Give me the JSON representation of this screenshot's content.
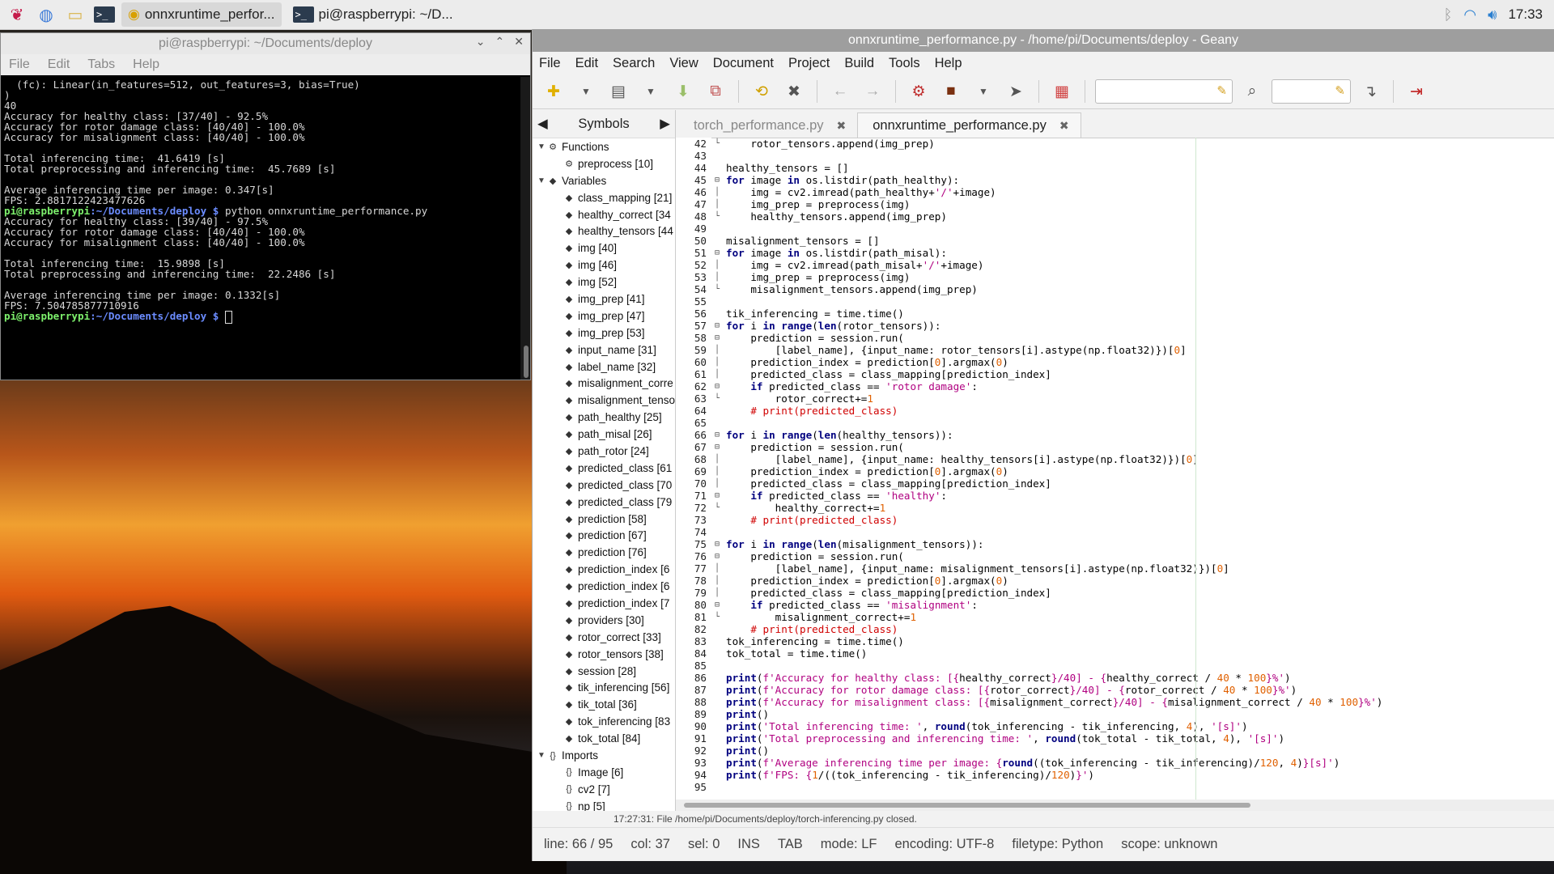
{
  "taskbar": {
    "tasks": [
      {
        "label": "onnxruntime_perfor..."
      },
      {
        "label": "pi@raspberrypi: ~/D..."
      }
    ],
    "clock": "17:33"
  },
  "terminal": {
    "title": "pi@raspberrypi: ~/Documents/deploy",
    "menu": [
      "File",
      "Edit",
      "Tabs",
      "Help"
    ],
    "lines": [
      "  (fc): Linear(in_features=512, out_features=3, bias=True)",
      ")",
      "40",
      "Accuracy for healthy class: [37/40] - 92.5%",
      "Accuracy for rotor damage class: [40/40] - 100.0%",
      "Accuracy for misalignment class: [40/40] - 100.0%",
      "",
      "Total inferencing time:  41.6419 [s]",
      "Total preprocessing and inferencing time:  45.7689 [s]",
      "",
      "Average inferencing time per image: 0.347[s]",
      "FPS: 2.8817122423477626",
      "PROMPT1",
      "Accuracy for healthy class: [39/40] - 97.5%",
      "Accuracy for rotor damage class: [40/40] - 100.0%",
      "Accuracy for misalignment class: [40/40] - 100.0%",
      "",
      "Total inferencing time:  15.9898 [s]",
      "Total preprocessing and inferencing time:  22.2486 [s]",
      "",
      "Average inferencing time per image: 0.1332[s]",
      "FPS: 7.504785877710916",
      "PROMPT2"
    ],
    "prompt_user": "pi@raspberrypi",
    "prompt_path": ":~/Documents/deploy $",
    "command1": " python onnxruntime_performance.py",
    "command2": " "
  },
  "geany": {
    "title": "onnxruntime_performance.py - /home/pi/Documents/deploy - Geany",
    "menu": [
      "File",
      "Edit",
      "Search",
      "View",
      "Document",
      "Project",
      "Build",
      "Tools",
      "Help"
    ],
    "sidebar_tab": "Symbols",
    "symbols": [
      {
        "depth": 0,
        "tw": "▼",
        "icon": "⚙",
        "label": "Functions"
      },
      {
        "depth": 1,
        "tw": "",
        "icon": "⚙",
        "label": "preprocess [10]"
      },
      {
        "depth": 0,
        "tw": "▼",
        "icon": "◆",
        "label": "Variables"
      },
      {
        "depth": 1,
        "tw": "",
        "icon": "◆",
        "label": "class_mapping [21]"
      },
      {
        "depth": 1,
        "tw": "",
        "icon": "◆",
        "label": "healthy_correct [34"
      },
      {
        "depth": 1,
        "tw": "",
        "icon": "◆",
        "label": "healthy_tensors [44"
      },
      {
        "depth": 1,
        "tw": "",
        "icon": "◆",
        "label": "img [40]"
      },
      {
        "depth": 1,
        "tw": "",
        "icon": "◆",
        "label": "img [46]"
      },
      {
        "depth": 1,
        "tw": "",
        "icon": "◆",
        "label": "img [52]"
      },
      {
        "depth": 1,
        "tw": "",
        "icon": "◆",
        "label": "img_prep [41]"
      },
      {
        "depth": 1,
        "tw": "",
        "icon": "◆",
        "label": "img_prep [47]"
      },
      {
        "depth": 1,
        "tw": "",
        "icon": "◆",
        "label": "img_prep [53]"
      },
      {
        "depth": 1,
        "tw": "",
        "icon": "◆",
        "label": "input_name [31]"
      },
      {
        "depth": 1,
        "tw": "",
        "icon": "◆",
        "label": "label_name [32]"
      },
      {
        "depth": 1,
        "tw": "",
        "icon": "◆",
        "label": "misalignment_corre"
      },
      {
        "depth": 1,
        "tw": "",
        "icon": "◆",
        "label": "misalignment_tenso"
      },
      {
        "depth": 1,
        "tw": "",
        "icon": "◆",
        "label": "path_healthy [25]"
      },
      {
        "depth": 1,
        "tw": "",
        "icon": "◆",
        "label": "path_misal [26]"
      },
      {
        "depth": 1,
        "tw": "",
        "icon": "◆",
        "label": "path_rotor [24]"
      },
      {
        "depth": 1,
        "tw": "",
        "icon": "◆",
        "label": "predicted_class [61"
      },
      {
        "depth": 1,
        "tw": "",
        "icon": "◆",
        "label": "predicted_class [70"
      },
      {
        "depth": 1,
        "tw": "",
        "icon": "◆",
        "label": "predicted_class [79"
      },
      {
        "depth": 1,
        "tw": "",
        "icon": "◆",
        "label": "prediction [58]"
      },
      {
        "depth": 1,
        "tw": "",
        "icon": "◆",
        "label": "prediction [67]"
      },
      {
        "depth": 1,
        "tw": "",
        "icon": "◆",
        "label": "prediction [76]"
      },
      {
        "depth": 1,
        "tw": "",
        "icon": "◆",
        "label": "prediction_index [6"
      },
      {
        "depth": 1,
        "tw": "",
        "icon": "◆",
        "label": "prediction_index [6"
      },
      {
        "depth": 1,
        "tw": "",
        "icon": "◆",
        "label": "prediction_index [7"
      },
      {
        "depth": 1,
        "tw": "",
        "icon": "◆",
        "label": "providers [30]"
      },
      {
        "depth": 1,
        "tw": "",
        "icon": "◆",
        "label": "rotor_correct [33]"
      },
      {
        "depth": 1,
        "tw": "",
        "icon": "◆",
        "label": "rotor_tensors [38]"
      },
      {
        "depth": 1,
        "tw": "",
        "icon": "◆",
        "label": "session [28]"
      },
      {
        "depth": 1,
        "tw": "",
        "icon": "◆",
        "label": "tik_inferencing [56]"
      },
      {
        "depth": 1,
        "tw": "",
        "icon": "◆",
        "label": "tik_total [36]"
      },
      {
        "depth": 1,
        "tw": "",
        "icon": "◆",
        "label": "tok_inferencing [83"
      },
      {
        "depth": 1,
        "tw": "",
        "icon": "◆",
        "label": "tok_total [84]"
      },
      {
        "depth": 0,
        "tw": "▼",
        "icon": "{}",
        "label": "Imports"
      },
      {
        "depth": 1,
        "tw": "",
        "icon": "{}",
        "label": "Image [6]"
      },
      {
        "depth": 1,
        "tw": "",
        "icon": "{}",
        "label": "cv2 [7]"
      },
      {
        "depth": 1,
        "tw": "",
        "icon": "{}",
        "label": "np [5]"
      }
    ],
    "tabs": [
      {
        "label": "torch_performance.py",
        "active": false
      },
      {
        "label": "onnxruntime_performance.py",
        "active": true
      }
    ],
    "code_lines": [
      {
        "n": "42",
        "f": "└",
        "h": "    rotor_tensors.append(img_prep)"
      },
      {
        "n": "43",
        "f": "",
        "h": ""
      },
      {
        "n": "44",
        "f": "",
        "h": "healthy_tensors = []"
      },
      {
        "n": "45",
        "f": "⊟",
        "h": "<span class='k'>for</span> image <span class='k'>in</span> os.listdir(path_healthy):"
      },
      {
        "n": "46",
        "f": "│",
        "h": "    img = cv2.imread(path_healthy+<span class='s'>'/'</span>+image)"
      },
      {
        "n": "47",
        "f": "│",
        "h": "    img_prep = preprocess(img)"
      },
      {
        "n": "48",
        "f": "└",
        "h": "    healthy_tensors.append(img_prep)"
      },
      {
        "n": "49",
        "f": "",
        "h": ""
      },
      {
        "n": "50",
        "f": "",
        "h": "misalignment_tensors = []"
      },
      {
        "n": "51",
        "f": "⊟",
        "h": "<span class='k'>for</span> image <span class='k'>in</span> os.listdir(path_misal):"
      },
      {
        "n": "52",
        "f": "│",
        "h": "    img = cv2.imread(path_misal+<span class='s'>'/'</span>+image)"
      },
      {
        "n": "53",
        "f": "│",
        "h": "    img_prep = preprocess(img)"
      },
      {
        "n": "54",
        "f": "└",
        "h": "    misalignment_tensors.append(img_prep)"
      },
      {
        "n": "55",
        "f": "",
        "h": ""
      },
      {
        "n": "56",
        "f": "",
        "h": "tik_inferencing = time.time()"
      },
      {
        "n": "57",
        "f": "⊟",
        "h": "<span class='k'>for</span> i <span class='k'>in</span> <span class='k'>range</span>(<span class='k'>len</span>(rotor_tensors)):"
      },
      {
        "n": "58",
        "f": "⊟",
        "h": "    prediction = session.run("
      },
      {
        "n": "59",
        "f": "│",
        "h": "        [label_name], {input_name: rotor_tensors[i].astype(np.float32)})[<span class='n'>0</span>]"
      },
      {
        "n": "60",
        "f": "│",
        "h": "    prediction_index = prediction[<span class='n'>0</span>].argmax(<span class='n'>0</span>)"
      },
      {
        "n": "61",
        "f": "│",
        "h": "    predicted_class = class_mapping[prediction_index]"
      },
      {
        "n": "62",
        "f": "⊟",
        "h": "    <span class='k'>if</span> predicted_class == <span class='s'>'rotor damage'</span>:"
      },
      {
        "n": "63",
        "f": "└",
        "h": "        rotor_correct+=<span class='n'>1</span>"
      },
      {
        "n": "64",
        "f": "",
        "h": "    <span class='cm'># print(predicted_class)</span>"
      },
      {
        "n": "65",
        "f": "",
        "h": ""
      },
      {
        "n": "66",
        "f": "⊟",
        "h": "<span class='k'>for</span> i <span class='k'>in</span> <span class='k'>range</span>(<span class='k'>len</span>(healthy_tensors)):"
      },
      {
        "n": "67",
        "f": "⊟",
        "h": "    prediction = session.run("
      },
      {
        "n": "68",
        "f": "│",
        "h": "        [label_name], {input_name: healthy_tensors[i].astype(np.float32)})[<span class='n'>0</span>]"
      },
      {
        "n": "69",
        "f": "│",
        "h": "    prediction_index = prediction[<span class='n'>0</span>].argmax(<span class='n'>0</span>)"
      },
      {
        "n": "70",
        "f": "│",
        "h": "    predicted_class = class_mapping[prediction_index]"
      },
      {
        "n": "71",
        "f": "⊟",
        "h": "    <span class='k'>if</span> predicted_class == <span class='s'>'healthy'</span>:"
      },
      {
        "n": "72",
        "f": "└",
        "h": "        healthy_correct+=<span class='n'>1</span>"
      },
      {
        "n": "73",
        "f": "",
        "h": "    <span class='cm'># print(predicted_class)</span>"
      },
      {
        "n": "74",
        "f": "",
        "h": ""
      },
      {
        "n": "75",
        "f": "⊟",
        "h": "<span class='k'>for</span> i <span class='k'>in</span> <span class='k'>range</span>(<span class='k'>len</span>(misalignment_tensors)):"
      },
      {
        "n": "76",
        "f": "⊟",
        "h": "    prediction = session.run("
      },
      {
        "n": "77",
        "f": "│",
        "h": "        [label_name], {input_name: misalignment_tensors[i].astype(np.float32)})[<span class='n'>0</span>]"
      },
      {
        "n": "78",
        "f": "│",
        "h": "    prediction_index = prediction[<span class='n'>0</span>].argmax(<span class='n'>0</span>)"
      },
      {
        "n": "79",
        "f": "│",
        "h": "    predicted_class = class_mapping[prediction_index]"
      },
      {
        "n": "80",
        "f": "⊟",
        "h": "    <span class='k'>if</span> predicted_class == <span class='s'>'misalignment'</span>:"
      },
      {
        "n": "81",
        "f": "└",
        "h": "        misalignment_correct+=<span class='n'>1</span>"
      },
      {
        "n": "82",
        "f": "",
        "h": "    <span class='cm'># print(predicted_class)</span>"
      },
      {
        "n": "83",
        "f": "",
        "h": "tok_inferencing = time.time()"
      },
      {
        "n": "84",
        "f": "",
        "h": "tok_total = time.time()"
      },
      {
        "n": "85",
        "f": "",
        "h": ""
      },
      {
        "n": "86",
        "f": "",
        "h": "<span class='k'>print</span>(<span class='s'>f'Accuracy for healthy class: [{</span>healthy_correct<span class='s'>}/40] - {</span>healthy_correct / <span class='n'>40</span> * <span class='n'>100</span><span class='s'>}%'</span>)"
      },
      {
        "n": "87",
        "f": "",
        "h": "<span class='k'>print</span>(<span class='s'>f'Accuracy for rotor damage class: [{</span>rotor_correct<span class='s'>}/40] - {</span>rotor_correct / <span class='n'>40</span> * <span class='n'>100</span><span class='s'>}%'</span>)"
      },
      {
        "n": "88",
        "f": "",
        "h": "<span class='k'>print</span>(<span class='s'>f'Accuracy for misalignment class: [{</span>misalignment_correct<span class='s'>}/40] - {</span>misalignment_correct / <span class='n'>40</span> * <span class='n'>100</span><span class='s'>}%'</span>)"
      },
      {
        "n": "89",
        "f": "",
        "h": "<span class='k'>print</span>()"
      },
      {
        "n": "90",
        "f": "",
        "h": "<span class='k'>print</span>(<span class='s'>'Total inferencing time: '</span>, <span class='k'>round</span>(tok_inferencing - tik_inferencing, <span class='n'>4</span>), <span class='s'>'[s]'</span>)"
      },
      {
        "n": "91",
        "f": "",
        "h": "<span class='k'>print</span>(<span class='s'>'Total preprocessing and inferencing time: '</span>, <span class='k'>round</span>(tok_total - tik_total, <span class='n'>4</span>), <span class='s'>'[s]'</span>)"
      },
      {
        "n": "92",
        "f": "",
        "h": "<span class='k'>print</span>()"
      },
      {
        "n": "93",
        "f": "",
        "h": "<span class='k'>print</span>(<span class='s'>f'Average inferencing time per image: {</span><span class='k'>round</span>((tok_inferencing - tik_inferencing)/<span class='n'>120</span>, <span class='n'>4</span>)<span class='s'>}[s]'</span>)"
      },
      {
        "n": "94",
        "f": "",
        "h": "<span class='k'>print</span>(<span class='s'>f'FPS: {</span><span class='n'>1</span>/((tok_inferencing - tik_inferencing)/<span class='n'>120</span>)<span class='s'>}'</span>)"
      },
      {
        "n": "95",
        "f": "",
        "h": ""
      }
    ],
    "message": "17:27:31: File /home/pi/Documents/deploy/torch-inferencing.py closed.",
    "status": [
      "line: 66 / 95",
      "col: 37",
      "sel: 0",
      "INS",
      "TAB",
      "mode: LF",
      "encoding: UTF-8",
      "filetype: Python",
      "scope: unknown"
    ]
  }
}
